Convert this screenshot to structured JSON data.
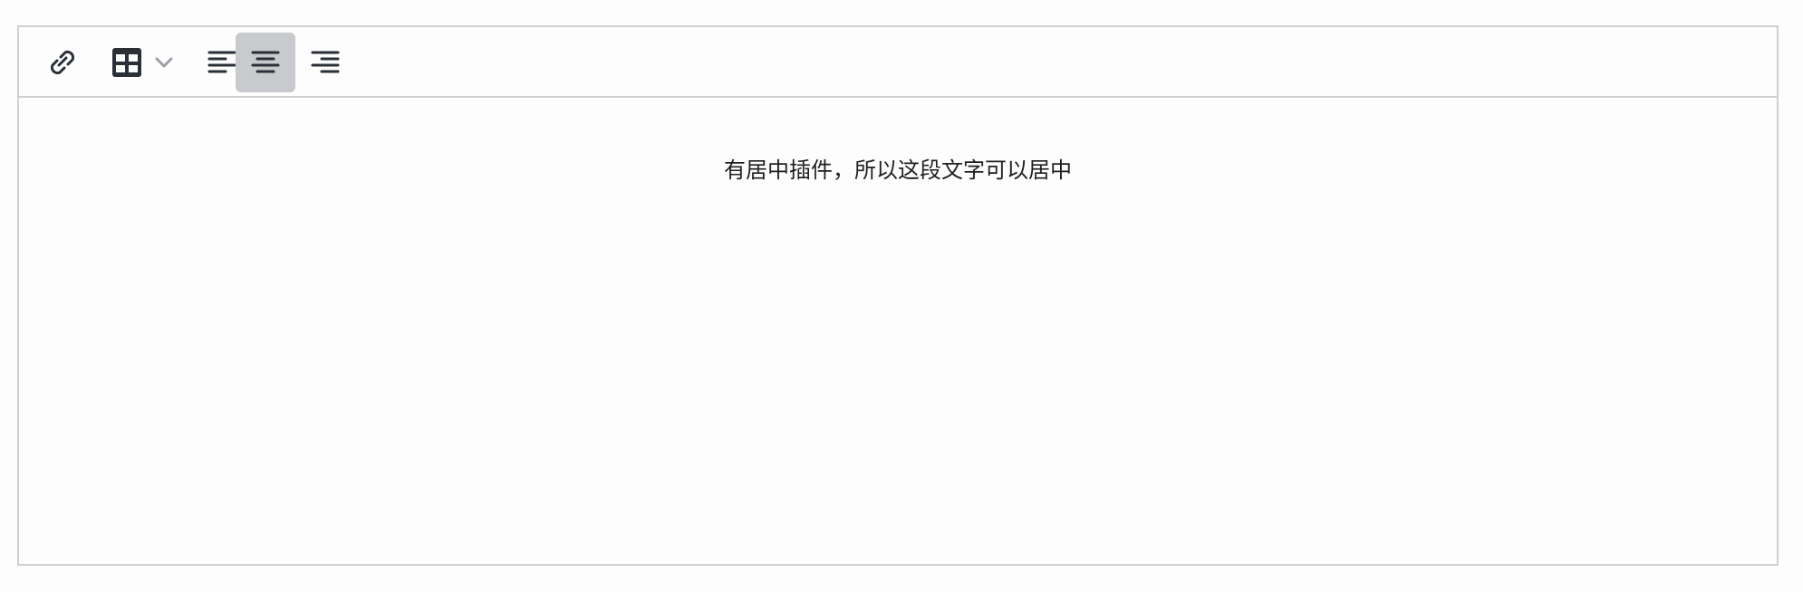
{
  "editor": {
    "toolbar": {
      "buttons": [
        {
          "icon": "link-icon"
        },
        {
          "icon": "table-icon"
        },
        {
          "icon": "align-left-icon"
        },
        {
          "icon": "align-center-icon",
          "active": true
        },
        {
          "icon": "align-right-icon"
        }
      ]
    },
    "content": {
      "paragraph": "有居中插件，所以这段文字可以居中"
    }
  },
  "colors": {
    "border": "#cfcfd1",
    "active_bg": "#c9cacd",
    "icon": "#2a2f38",
    "chevron": "#9aa0a8"
  }
}
